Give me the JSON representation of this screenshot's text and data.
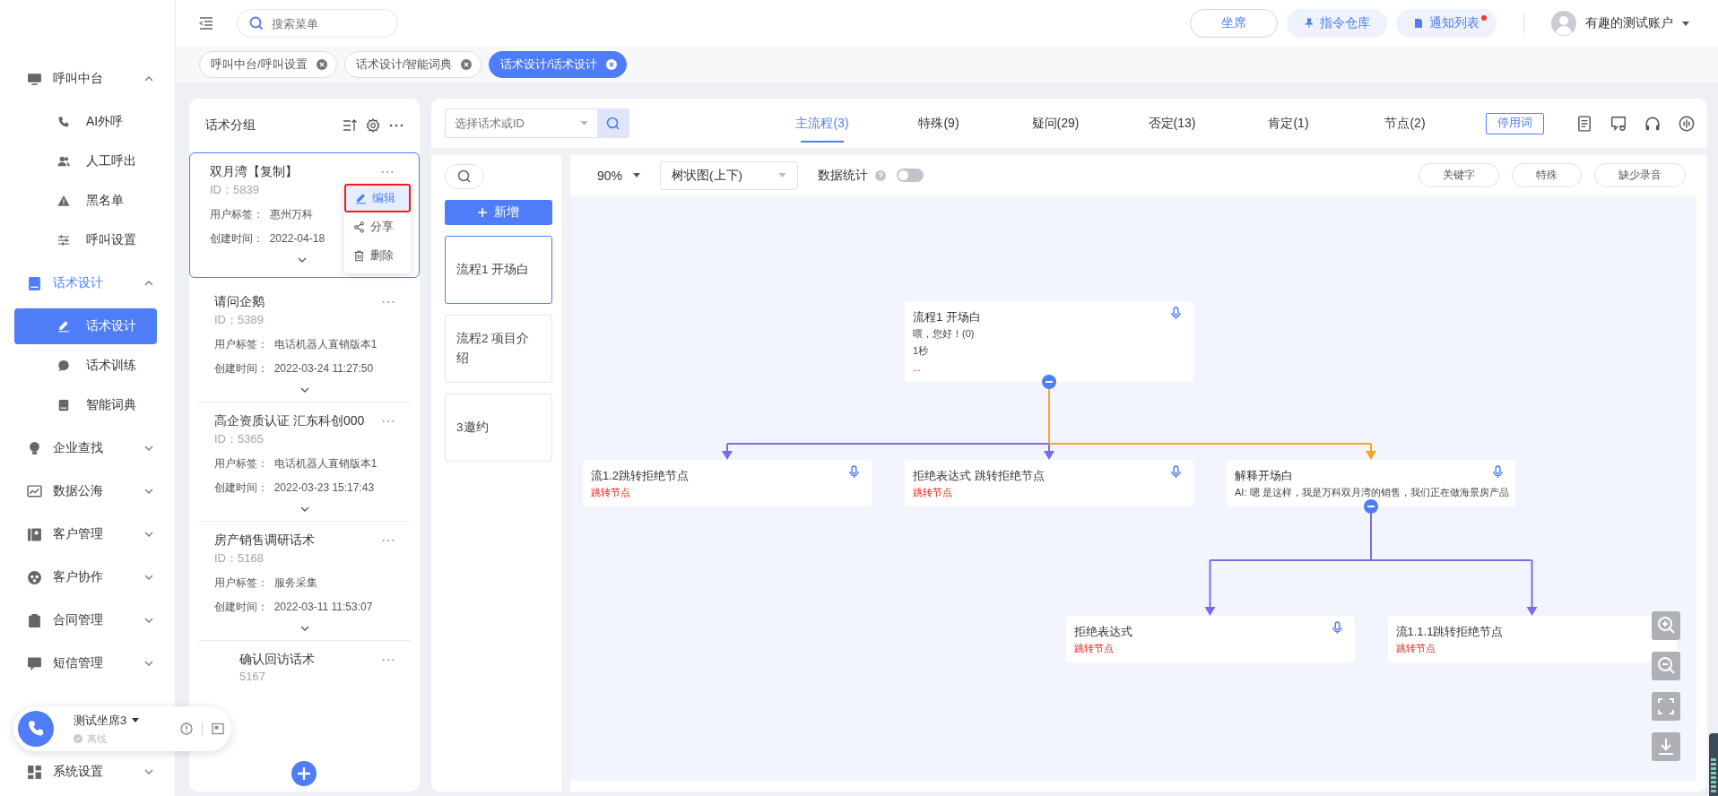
{
  "sidebar": {
    "groups": [
      {
        "label": "呼叫中台",
        "active": false,
        "expanded": true,
        "children": [
          {
            "label": "AI外呼",
            "selected": false
          },
          {
            "label": "人工呼出",
            "selected": false
          },
          {
            "label": "黑名单",
            "selected": false
          },
          {
            "label": "呼叫设置",
            "selected": false
          }
        ]
      },
      {
        "label": "话术设计",
        "active": true,
        "expanded": true,
        "children": [
          {
            "label": "话术设计",
            "selected": true
          },
          {
            "label": "话术训练",
            "selected": false
          },
          {
            "label": "智能词典",
            "selected": false
          }
        ]
      },
      {
        "label": "企业查找",
        "active": false,
        "expanded": false
      },
      {
        "label": "数据公海",
        "active": false,
        "expanded": false
      },
      {
        "label": "客户管理",
        "active": false,
        "expanded": false
      },
      {
        "label": "客户协作",
        "active": false,
        "expanded": false
      },
      {
        "label": "合同管理",
        "active": false,
        "expanded": false
      },
      {
        "label": "短信管理",
        "active": false,
        "expanded": false
      },
      {
        "label": "系统设置",
        "active": false,
        "expanded": false
      }
    ]
  },
  "topbar": {
    "search_placeholder": "搜索菜单",
    "buttons": [
      {
        "label": "坐席",
        "kind": "outline",
        "badge": false
      },
      {
        "label": "指令仓库",
        "kind": "soft",
        "badge": false
      },
      {
        "label": "通知列表",
        "kind": "soft",
        "badge": true
      }
    ],
    "user": "有趣的测试账户"
  },
  "open_tabs": [
    {
      "label": "呼叫中台/呼叫设置",
      "selected": false
    },
    {
      "label": "话术设计/智能词典",
      "selected": false
    },
    {
      "label": "话术设计/话术设计",
      "selected": true
    }
  ],
  "script_groups": {
    "title": "话术分组",
    "items": [
      {
        "name": "双月湾【复制】",
        "id": "ID：5839",
        "tag_label": "用户标签：",
        "tag": "惠州万科",
        "created_label": "创建时间：",
        "created": "2022-04-18",
        "selected": true,
        "covered": false
      },
      {
        "name": "请问企鹅",
        "id": "ID：5389",
        "tag_label": "用户标签：",
        "tag": "电话机器人直销版本1",
        "created_label": "创建时间：",
        "created": "2022-03-24 11:27:50",
        "selected": false,
        "covered": false
      },
      {
        "name": "高企资质认证 汇东科创000",
        "id": "ID：5365",
        "tag_label": "用户标签：",
        "tag": "电话机器人直销版本1",
        "created_label": "创建时间：",
        "created": "2022-03-23 15:17:43",
        "selected": false,
        "covered": false
      },
      {
        "name": "房产销售调研话术",
        "id": "ID：5168",
        "tag_label": "用户标签：",
        "tag": "服务采集",
        "created_label": "创建时间：",
        "created": "2022-03-11 11:53:07",
        "selected": false,
        "covered": false
      },
      {
        "name": "确认回访话术",
        "id": "5167",
        "selected": false,
        "covered": true
      }
    ],
    "menu": [
      {
        "label": "编辑",
        "selected": true,
        "highlighted": true
      },
      {
        "label": "分享",
        "selected": false,
        "highlighted": false
      },
      {
        "label": "删除",
        "selected": false,
        "highlighted": false
      }
    ]
  },
  "flow": {
    "search_placeholder": "选择话术或ID",
    "tabs": [
      {
        "label": "主流程(3)",
        "selected": true
      },
      {
        "label": "特殊(9)",
        "selected": false
      },
      {
        "label": "疑问(29)",
        "selected": false
      },
      {
        "label": "否定(13)",
        "selected": false
      },
      {
        "label": "肯定(1)",
        "selected": false
      },
      {
        "label": "节点(2)",
        "selected": false
      }
    ],
    "stopwords_button": "停用词",
    "add_button": "新增",
    "flows": [
      {
        "label": "流程1 开场白",
        "selected": true
      },
      {
        "label": "流程2 项目介绍",
        "selected": false
      },
      {
        "label": "3邀约",
        "selected": false
      }
    ],
    "zoom": "90%",
    "layout": "树状图(上下)",
    "stats_label": "数据统计",
    "stats_on": false,
    "filters": [
      "关键字",
      "特殊",
      "缺少录音"
    ],
    "root": {
      "title": "流程1 开场白",
      "lines": [
        "喂，您好！(0)",
        "1秒"
      ],
      "tag": "...",
      "audio": true,
      "expanded": true,
      "children": [
        {
          "title": "流1.2跳转拒绝节点",
          "tag": "跳转节点",
          "audio": true,
          "color": "#7b6be6"
        },
        {
          "title": "拒绝表达式 跳转拒绝节点",
          "tag": "跳转节点",
          "audio": true,
          "color": "#7b6be6"
        },
        {
          "title": "解释开场白",
          "lines": [
            "AI: 嗯 是这样，我是万科双月湾的销售，我们正在做海景房产品"
          ],
          "audio": true,
          "color": "#f5a623",
          "expanded": true,
          "children": [
            {
              "title": "拒绝表达式",
              "tag": "跳转节点",
              "audio": true,
              "color": "#7b6be6"
            },
            {
              "title": "流1.1.1跳转拒绝节点",
              "tag": "跳转节点",
              "color": "#7b6be6"
            }
          ]
        }
      ]
    }
  },
  "call_widget": {
    "seat": "测试坐席3",
    "status": "离线"
  }
}
